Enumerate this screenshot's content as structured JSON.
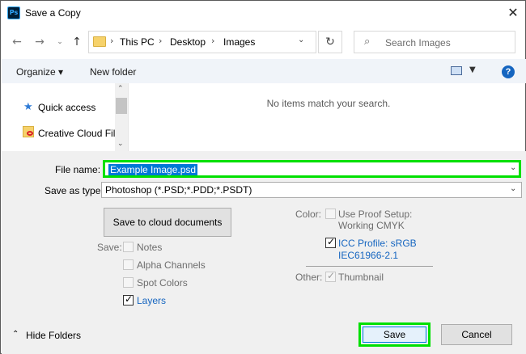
{
  "window": {
    "title": "Save a Copy",
    "app_icon": "Ps"
  },
  "nav": {
    "breadcrumb": [
      "This PC",
      "Desktop",
      "Images"
    ],
    "search_placeholder": "Search Images"
  },
  "toolbar": {
    "organize": "Organize ▾",
    "new_folder": "New folder",
    "help": "?"
  },
  "sidebar": {
    "items": [
      {
        "label": "Quick access",
        "icon": "star-icon"
      },
      {
        "label": "Creative Cloud Fil",
        "icon": "creative-cloud-folder-icon"
      }
    ]
  },
  "filelist": {
    "empty_message": "No items match your search."
  },
  "form": {
    "file_name_label": "File name:",
    "file_name_value": "Example Image.psd",
    "save_as_type_label": "Save as type:",
    "save_as_type_value": "Photoshop (*.PSD;*.PDD;*.PSDT)",
    "cloud_button": "Save to cloud documents"
  },
  "save_options": {
    "label": "Save:",
    "notes": {
      "label": "Notes",
      "checked": false,
      "enabled": false
    },
    "alpha_channels": {
      "label": "Alpha Channels",
      "checked": false,
      "enabled": false
    },
    "spot_colors": {
      "label": "Spot Colors",
      "checked": false,
      "enabled": false
    },
    "layers": {
      "label": "Layers",
      "checked": true,
      "enabled": true
    }
  },
  "color_options": {
    "label": "Color:",
    "proof_line1": "Use Proof Setup:",
    "proof_line2": "Working CMYK",
    "icc_line1": "ICC Profile:  sRGB",
    "icc_line2": "IEC61966-2.1",
    "icc_checked": true
  },
  "other_options": {
    "label": "Other:",
    "thumbnail": "Thumbnail",
    "thumbnail_checked": true
  },
  "footer": {
    "hide_folders": "Hide Folders",
    "save": "Save",
    "cancel": "Cancel"
  },
  "colors": {
    "highlight": "#00e000",
    "selection": "#0078d7",
    "link": "#1565c0"
  }
}
